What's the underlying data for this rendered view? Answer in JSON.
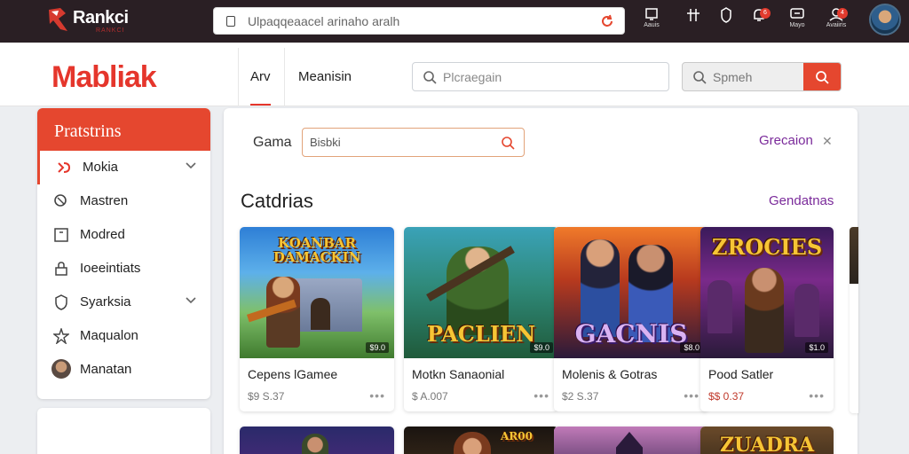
{
  "topbar": {
    "brand": "Rankci",
    "brand_sub": "RANKCI",
    "address": "Ulpaqqeaacel arinaho aralh",
    "icons": [
      {
        "name": "box-icon",
        "label": "Aauis"
      },
      {
        "name": "hash-icon",
        "label": ""
      },
      {
        "name": "shield-icon",
        "label": ""
      },
      {
        "name": "bell-icon",
        "label": "",
        "badge": "6"
      },
      {
        "name": "chat-icon",
        "label": "Mayo"
      },
      {
        "name": "user-icon",
        "label": "Avaiiris",
        "badge": "4"
      }
    ]
  },
  "header": {
    "brand": "Mabliak",
    "tabs": [
      "Arv",
      "Meanisin"
    ],
    "search_placeholder": "Plcraegain",
    "search2_placeholder": "Spmeh"
  },
  "sidebar": {
    "title": "Pratstrins",
    "items": [
      {
        "label": "Mokia",
        "icon": "gamepad-icon",
        "chevron": true
      },
      {
        "label": "Mastren",
        "icon": "search-icon",
        "chevron": false
      },
      {
        "label": "Modred",
        "icon": "square-icon",
        "chevron": false
      },
      {
        "label": "Ioeeintiats",
        "icon": "lock-icon",
        "chevron": false
      },
      {
        "label": "Syarksia",
        "icon": "shield-icon",
        "chevron": true
      },
      {
        "label": "Maqualon",
        "icon": "star-icon",
        "chevron": false
      },
      {
        "label": "Manatan",
        "icon": "avatar-icon",
        "chevron": false
      }
    ]
  },
  "main": {
    "game_label": "Gama",
    "game_value": "Bisbki",
    "action_link": "Grecaion",
    "section_title": "Catdrias",
    "section_link": "Gendatnas",
    "cards": [
      {
        "name": "Cepens lGamee",
        "price": "$9 S.37",
        "art_title": "KOANBAR DAMACKIN",
        "tag": "$9.0",
        "price_red": false
      },
      {
        "name": "Motkn Sanaonial",
        "price": "$ A.007",
        "art_title": "PACLIEN",
        "tag": "$9.0",
        "price_red": false
      },
      {
        "name": "Molenis & Gotras",
        "price": "$2 S.37",
        "art_title": "GACNIS",
        "tag": "$8.0",
        "price_red": false
      },
      {
        "name": "Pood Satler",
        "price": "$$ 0.37",
        "art_title": "ZROCIES",
        "tag": "$1.0",
        "price_red": true
      }
    ],
    "second_row": [
      {
        "art_title": ""
      },
      {
        "art_title": "AR00"
      },
      {
        "art_title": ""
      },
      {
        "art_title": "ZUADRA"
      }
    ]
  },
  "colors": {
    "accent": "#e5472f",
    "brand": "#e5362c",
    "link": "#7a2a9a",
    "topbar": "#2a1f24"
  }
}
